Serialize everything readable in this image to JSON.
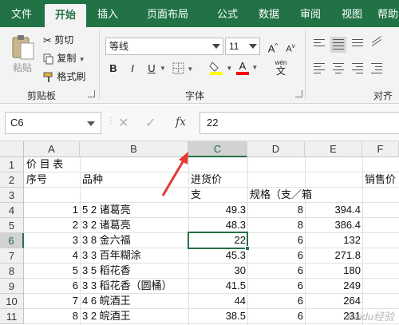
{
  "tabs": [
    "文件",
    "开始",
    "插入",
    "页面布局",
    "公式",
    "数据",
    "审阅",
    "视图",
    "帮助"
  ],
  "active_tab": "开始",
  "clipboard": {
    "paste_label": "粘贴",
    "cut_label": "剪切",
    "copy_label": "复制",
    "format_painter_label": "格式刷",
    "group_label": "剪贴板"
  },
  "font": {
    "font_name": "等线",
    "font_size": "11",
    "bold_label": "B",
    "italic_label": "I",
    "underline_label": "U",
    "grow_label": "A",
    "shrink_label": "A",
    "wen_label": "wén",
    "wen_char": "文",
    "font_color_label": "A",
    "group_label": "字体",
    "fill_color": "#ffff00",
    "font_color": "#ff0000"
  },
  "alignment": {
    "group_label": "对齐方"
  },
  "formula_bar": {
    "name_box": "C6",
    "fx_label": "fx",
    "value": "22"
  },
  "grid": {
    "columns": [
      "A",
      "B",
      "C",
      "D",
      "E",
      "F"
    ],
    "selected_column": "C",
    "rows": [
      "1",
      "2",
      "3",
      "4",
      "5",
      "6",
      "7",
      "8",
      "9",
      "10",
      "11"
    ],
    "selected_row": "6",
    "cells": {
      "A1": "价 目 表",
      "A2": "序号",
      "B2": "品种",
      "C2": "进货价",
      "F2": "销售价",
      "C3": "支",
      "D3": "规格（支／箱",
      "A4": "1",
      "B4": "5 2 诸葛亮",
      "C4": "49.3",
      "D4": "8",
      "E4": "394.4",
      "A5": "2",
      "B5": "3 2 诸葛亮",
      "C5": "48.3",
      "D5": "8",
      "E5": "386.4",
      "A6": "3",
      "B6": "3 8 金六福",
      "C6": "22",
      "D6": "6",
      "E6": "132",
      "A7": "4",
      "B7": "3 3 百年糊涂",
      "C7": "45.3",
      "D7": "6",
      "E7": "271.8",
      "A8": "5",
      "B8": "3 5 稻花香",
      "C8": "30",
      "D8": "6",
      "E8": "180",
      "A9": "6",
      "B9": "3 3 稻花香（圆桶）",
      "C9": "41.5",
      "D9": "6",
      "E9": "249",
      "A10": "7",
      "B10": "4 6 皖酒王",
      "C10": "44",
      "D10": "6",
      "E10": "264",
      "A11": "8",
      "B11": "3 2 皖酒王",
      "C11": "38.5",
      "D11": "6",
      "E11": "231"
    }
  },
  "annotation_arrow_color": "#e53935",
  "watermark": "Baidu经验"
}
